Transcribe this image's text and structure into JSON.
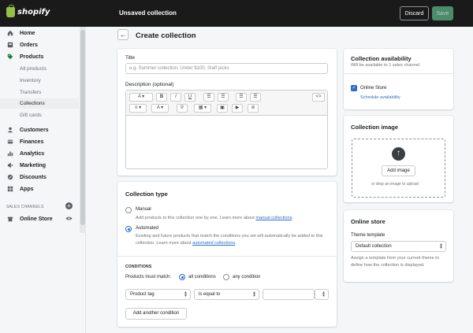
{
  "topbar": {
    "logo_text": "shopify",
    "status": "Unsaved collection",
    "discard_label": "Discard",
    "save_label": "Save"
  },
  "sidebar": {
    "items": [
      {
        "label": "Home",
        "icon": "home-icon"
      },
      {
        "label": "Orders",
        "icon": "orders-icon"
      },
      {
        "label": "Products",
        "icon": "tag-icon"
      }
    ],
    "product_subitems": [
      "All products",
      "Inventory",
      "Transfers",
      "Collections",
      "Gift cards"
    ],
    "active_subitem": "Collections",
    "items2": [
      {
        "label": "Customers",
        "icon": "customers-icon"
      },
      {
        "label": "Finances",
        "icon": "finances-icon"
      },
      {
        "label": "Analytics",
        "icon": "analytics-icon"
      },
      {
        "label": "Marketing",
        "icon": "marketing-icon"
      },
      {
        "label": "Discounts",
        "icon": "discounts-icon"
      },
      {
        "label": "Apps",
        "icon": "apps-icon"
      }
    ],
    "channels_header": "SALES CHANNELS",
    "online_store_label": "Online Store"
  },
  "page": {
    "title": "Create collection"
  },
  "details": {
    "title_label": "Title",
    "title_placeholder": "e.g. Summer collection, Under $100, Staff picks",
    "description_label": "Description (optional)"
  },
  "collection_type": {
    "heading": "Collection type",
    "manual_label": "Manual",
    "manual_desc": "Add products to this collection one by one. Learn more about ",
    "manual_link": "manual collections",
    "automated_label": "Automated",
    "automated_desc": "Existing and future products that match the conditions you set will automatically be added to this collection. Learn more about ",
    "automated_link": "automated collections",
    "selected": "Automated"
  },
  "conditions": {
    "heading": "CONDITIONS",
    "must_match_label": "Products must match:",
    "all_label": "all conditions",
    "any_label": "any condition",
    "selected": "all conditions",
    "field_value": "Product tag",
    "operator_value": "is equal to",
    "value_input": "",
    "add_button": "Add another condition"
  },
  "availability": {
    "heading": "Collection availability",
    "subtext": "Will be available to 1 sales channel.",
    "channel_label": "Online Store",
    "channel_checked": true,
    "schedule_link": "Schedule availability"
  },
  "image": {
    "heading": "Collection image",
    "add_button": "Add image",
    "drop_text": "or drop an image to upload"
  },
  "online_store": {
    "heading": "Online store",
    "template_label": "Theme template",
    "template_value": "Default collection",
    "help_text": "Assign a template from your current theme to define how the collection is displayed."
  },
  "colors": {
    "accent": "#2c6ecb",
    "topbar": "#1a1a1a",
    "save_button": "#4c8b6b",
    "brand_green": "#95bf47"
  }
}
